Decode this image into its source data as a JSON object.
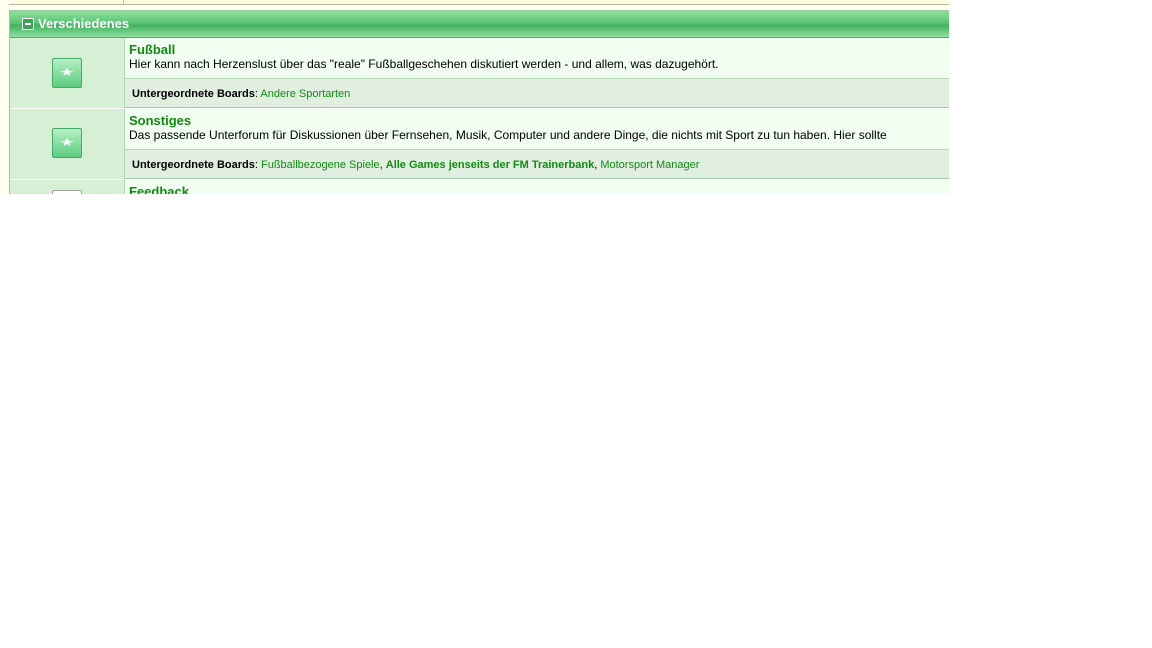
{
  "category": {
    "title": "Verschiedenes",
    "collapse_icon": "collapse-minus-icon"
  },
  "boards": [
    {
      "name": "Fußball",
      "description": "Hier kann nach Herzenslust über das \"reale\" Fußballgeschehen diskutiert werden - und allem, was dazugehört.",
      "icon": "board-new-posts-icon",
      "children_label": "Untergeordnete Boards",
      "children": [
        "Andere Sportarten"
      ]
    },
    {
      "name": "Sonstiges",
      "description": "Das passende Unterforum für Diskussionen über Fernsehen, Musik, Computer und andere Dinge, die nichts mit Sport zu tun haben. Hier sollte",
      "icon": "board-new-posts-icon",
      "children_label": "Untergeordnete Boards",
      "children": [
        "Fußballbezogene Spiele",
        "Alle Games jenseits der FM Trainerbank",
        "Motorsport Manager"
      ]
    },
    {
      "name": "Feedback",
      "icon": "board-icon"
    }
  ],
  "colors": {
    "header_green": "#4fbd6b",
    "link_green": "#138a13",
    "icon_cell": "#d6f0d6"
  }
}
